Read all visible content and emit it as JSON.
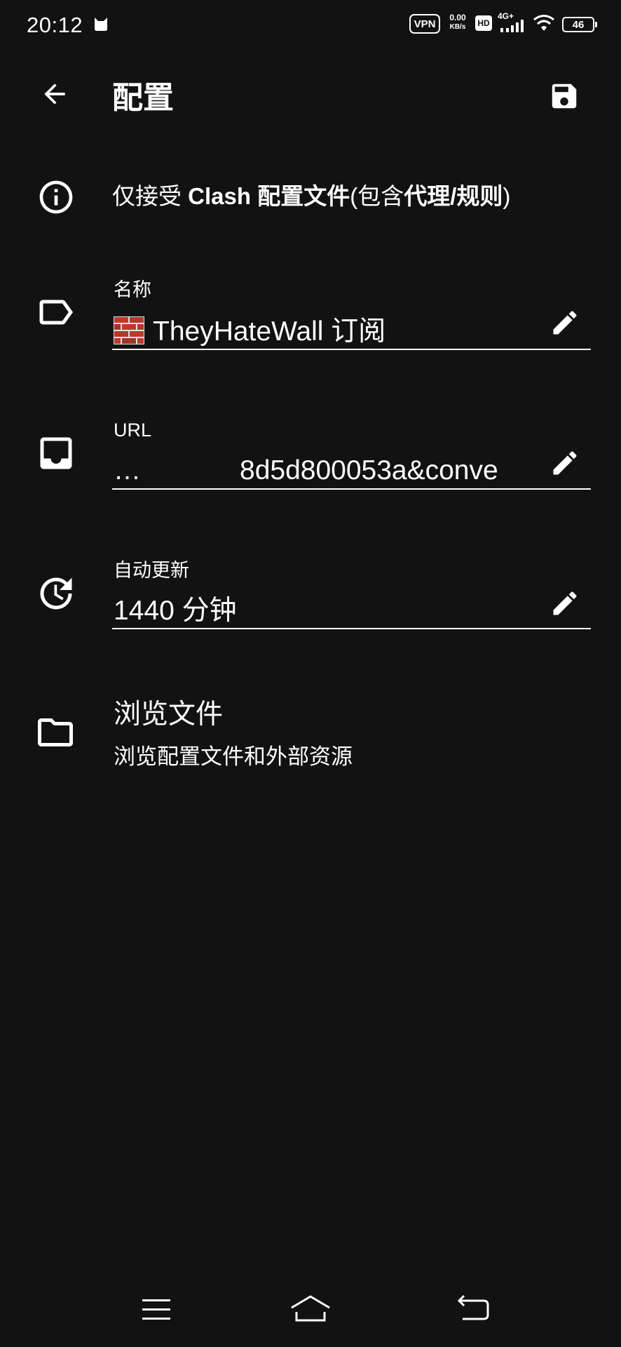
{
  "status_bar": {
    "time": "20:12",
    "vpn": "VPN",
    "speed_value": "0.00",
    "speed_unit": "KB/s",
    "hd": "HD",
    "network": "4G+",
    "battery": "46",
    "battery_level": 0.46
  },
  "app_bar": {
    "title": "配置"
  },
  "info": {
    "prefix": "仅接受 ",
    "bold1": "Clash 配置文件",
    "mid": "(包含",
    "bold2": "代理",
    "slash": "/",
    "bold3": "规则",
    "suffix": ")"
  },
  "fields": {
    "name": {
      "label": "名称",
      "value": "TheyHateWall 订阅"
    },
    "url": {
      "label": "URL",
      "dots": "…",
      "value": "8d5d800053a&conve"
    },
    "auto_update": {
      "label": "自动更新",
      "value": "1440 分钟"
    }
  },
  "browse": {
    "title": "浏览文件",
    "subtitle": "浏览配置文件和外部资源"
  },
  "icons": {
    "back": "arrow-back-icon",
    "save": "save-icon",
    "info": "info-icon",
    "name": "label-icon",
    "url": "inbox-icon",
    "auto_update": "history-icon",
    "browse": "folder-icon",
    "edit": "pencil-icon"
  },
  "colors": {
    "background": "#121212",
    "foreground": "#ffffff"
  }
}
